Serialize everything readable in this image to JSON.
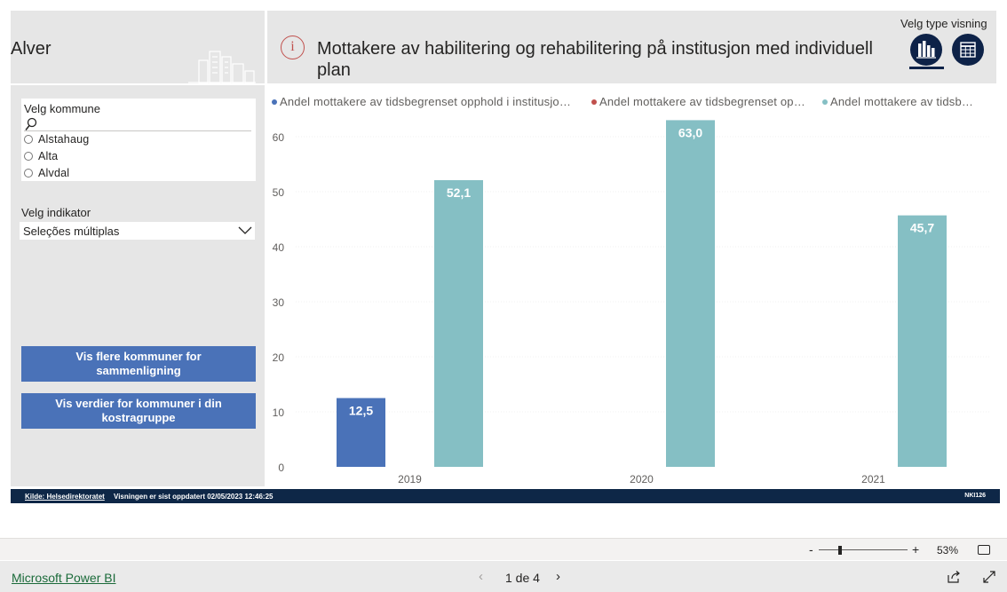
{
  "sidebar": {
    "municipality": "Alver",
    "slicer": {
      "title": "Velg kommune",
      "items": [
        "Alstahaug",
        "Alta",
        "Alvdal"
      ]
    },
    "indicator": {
      "label": "Velg indikator",
      "value": "Seleções múltiplas"
    },
    "buttons": {
      "compare": "Vis flere kommuner for sammenligning",
      "kostra": "Vis verdier for kommuner i din kostragruppe"
    }
  },
  "header": {
    "title": "Mottakere av habilitering og rehabilitering på institusjon med individuell plan",
    "view_label": "Velg type visning"
  },
  "chart_data": {
    "type": "bar",
    "categories": [
      "2019",
      "2020",
      "2021"
    ],
    "series": [
      {
        "name": "Andel  mottakere av tidsbegrenset opphold i institusjo…",
        "color": "#4a72b8",
        "values": [
          12.5,
          null,
          null
        ],
        "labels": [
          "12,5",
          "",
          ""
        ]
      },
      {
        "name": "Andel  mottakere av tidsbegrenset op…",
        "color": "#c0504d",
        "values": [
          null,
          null,
          null
        ],
        "labels": [
          "",
          "",
          ""
        ]
      },
      {
        "name": "Andel  mottakere av tidsb…",
        "color": "#85bfc4",
        "values": [
          52.1,
          63.0,
          45.7
        ],
        "labels": [
          "52,1",
          "63,0",
          "45,7"
        ]
      }
    ],
    "y_ticks": [
      "0",
      "10",
      "20",
      "30",
      "40",
      "50",
      "60"
    ],
    "ylim": [
      0,
      65
    ],
    "grid": true,
    "legend": "top"
  },
  "footer": {
    "source": "Kilde: Helsedirektoratet",
    "updated": "Visningen er sist oppdatert 02/05/2023 12:46:25",
    "code": "NKI126"
  },
  "zoom": {
    "minus": "-",
    "plus": "+",
    "level": "53%"
  },
  "bottom": {
    "brand": "Microsoft Power BI",
    "page": "1 de 4"
  },
  "colors": {
    "accent": "#4a72b8",
    "navy": "#0e2747",
    "teal": "#85bfc4",
    "red": "#c0504d"
  }
}
